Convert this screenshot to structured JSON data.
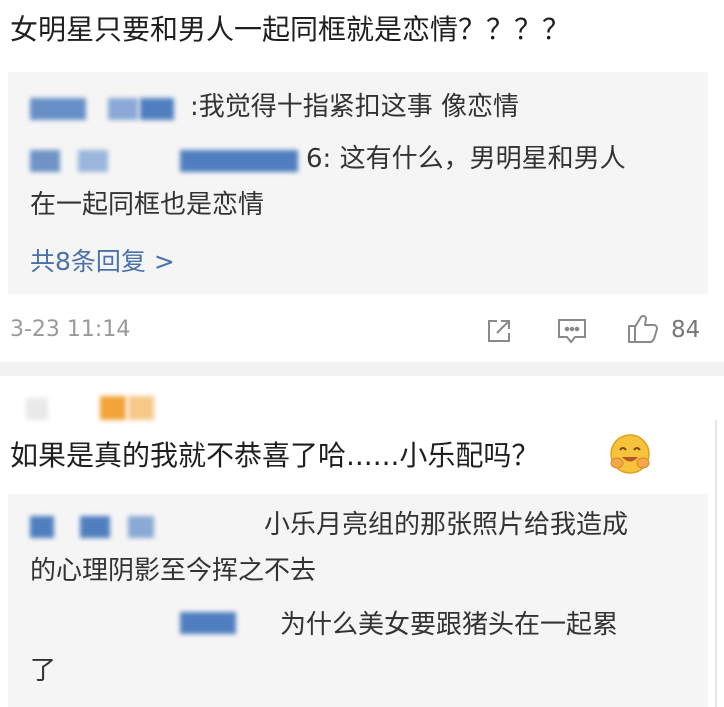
{
  "post_title": "女明星只要和男人一起同框就是恋情？？？？",
  "comment1": {
    "replies": [
      {
        "separator": ":",
        "text": "我觉得十指紧扣这事 像恋情"
      },
      {
        "author_suffix": "6:",
        "text_line1": "这有什么，男明星和男人",
        "text_line2": "在一起同框也是恋情"
      }
    ],
    "more_replies": "共8条回复 >",
    "timestamp": "3-23 11:14",
    "like_count": "84",
    "icons": [
      "share-icon",
      "comment-icon",
      "like-icon"
    ]
  },
  "comment2": {
    "text": "如果是真的我就不恭喜了哈......小乐配吗？",
    "emoji": "smiling-hug-emoji",
    "replies": [
      {
        "text_line1": "小乐月亮组的那张照片给我造成",
        "text_line2": "的心理阴影至今挥之不去"
      },
      {
        "text_line1": "为什么美女要跟猪头在一起累",
        "text_line2": "了"
      }
    ]
  },
  "colors": {
    "link": "#4a72a8",
    "reply_bg": "#f5f5f5",
    "emoji_yellow": "#f7c23c",
    "blur_blue": "#4f7fbf",
    "blur_orange": "#f2a43a"
  }
}
